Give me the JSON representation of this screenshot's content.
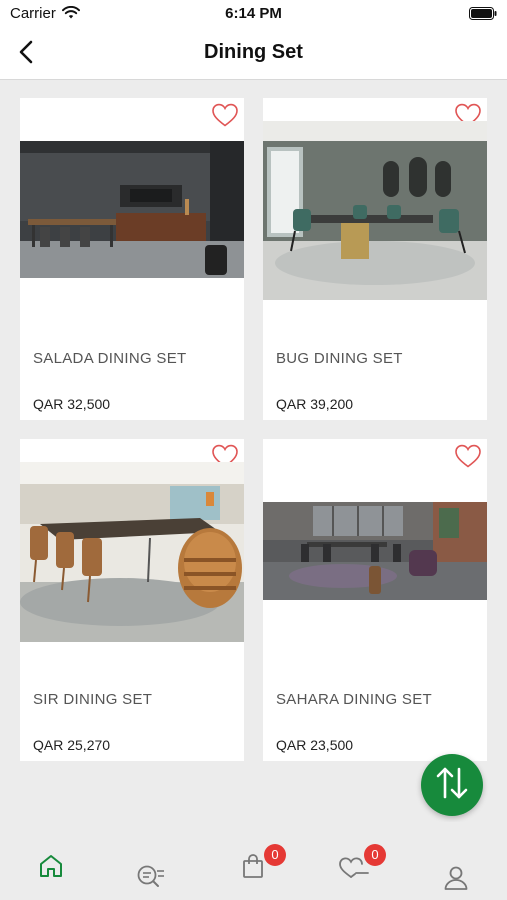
{
  "status_bar": {
    "carrier": "Carrier",
    "time": "6:14 PM"
  },
  "nav": {
    "title": "Dining Set"
  },
  "products": [
    {
      "name": "SALADA DINING SET",
      "price": "QAR 32,500"
    },
    {
      "name": "BUG DINING SET",
      "price": "QAR 39,200"
    },
    {
      "name": "SIR DINING SET",
      "price": "QAR 25,270"
    },
    {
      "name": "SAHARA DINING SET",
      "price": "QAR 23,500"
    }
  ],
  "tab_bar": {
    "cart_badge": "0",
    "wishlist_badge": "0"
  },
  "colors": {
    "accent": "#178a3c",
    "heart": "#e05555",
    "badge": "#e53935"
  },
  "icons": [
    "wifi-icon",
    "battery-icon",
    "back-arrow-icon",
    "heart-outline-icon",
    "sort-arrows-icon",
    "home-icon",
    "search-list-icon",
    "shopping-bag-icon",
    "heart-minus-icon",
    "user-icon"
  ]
}
